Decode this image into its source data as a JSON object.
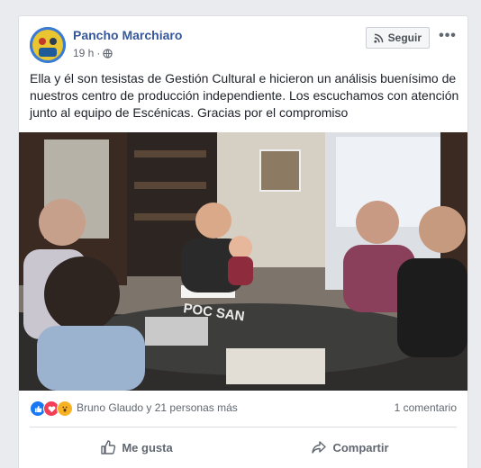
{
  "post": {
    "author": "Pancho Marchiaro",
    "time": "19 h",
    "follow_label": "Seguir",
    "more_label": "•••",
    "text": "Ella y él son tesistas de Gestión Cultural e hicieron un análisis buenísimo de nuestros centro de producción independiente. Los escuchamos con atención junto al equipo de Escénicas. Gracias por el compromiso",
    "photo_lettering": "POC SAN",
    "reactions_summary": "Bruno Glaudo y 21 personas más",
    "comments_count": "1 comentario",
    "actions": {
      "like": "Me gusta",
      "share": "Compartir"
    }
  },
  "colors": {
    "link": "#365899",
    "like_blue": "#1877f2",
    "love_red": "#f33e58",
    "wow_yellow": "#f7b125"
  }
}
